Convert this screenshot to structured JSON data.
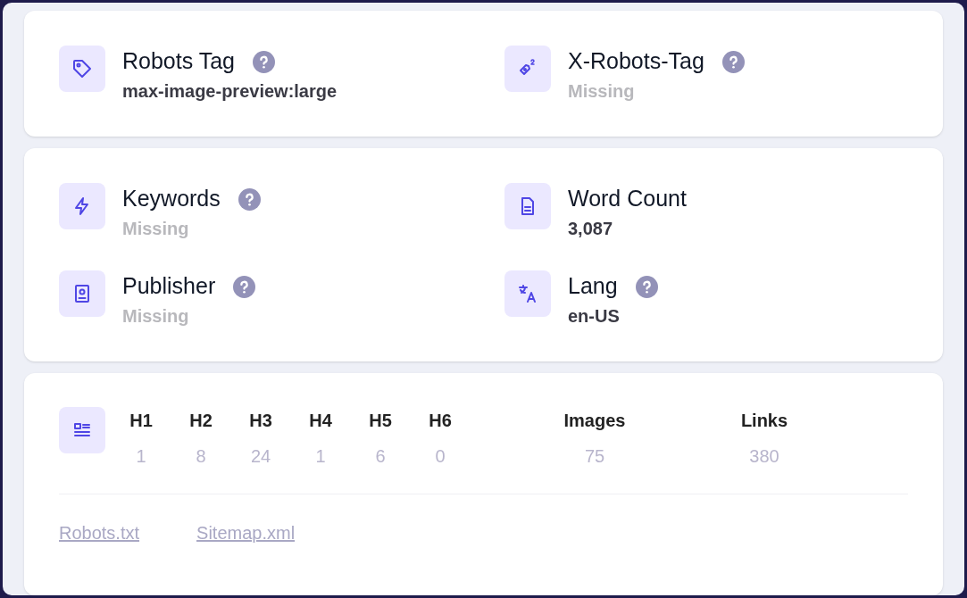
{
  "cards": [
    {
      "items": [
        {
          "kind": "tag",
          "label": "Robots Tag",
          "help": true,
          "value": "max-image-preview:large",
          "missing": false
        },
        {
          "kind": "tag-number",
          "label": "X-Robots-Tag",
          "help": true,
          "value": "Missing",
          "missing": true
        }
      ]
    },
    {
      "items": [
        {
          "kind": "bolt",
          "label": "Keywords",
          "help": true,
          "value": "Missing",
          "missing": true
        },
        {
          "kind": "document",
          "label": "Word Count",
          "help": false,
          "value": "3,087",
          "missing": false
        },
        {
          "kind": "badge",
          "label": "Publisher",
          "help": true,
          "value": "Missing",
          "missing": true
        },
        {
          "kind": "translate",
          "label": "Lang",
          "help": true,
          "value": "en-US",
          "missing": false
        }
      ]
    }
  ],
  "structure": {
    "headings": [
      {
        "label": "H1",
        "value": "1"
      },
      {
        "label": "H2",
        "value": "8"
      },
      {
        "label": "H3",
        "value": "24"
      },
      {
        "label": "H4",
        "value": "1"
      },
      {
        "label": "H5",
        "value": "6"
      },
      {
        "label": "H6",
        "value": "0"
      }
    ],
    "stats": [
      {
        "label": "Images",
        "value": "75"
      },
      {
        "label": "Links",
        "value": "380"
      }
    ],
    "links": [
      "Robots.txt",
      "Sitemap.xml"
    ]
  }
}
